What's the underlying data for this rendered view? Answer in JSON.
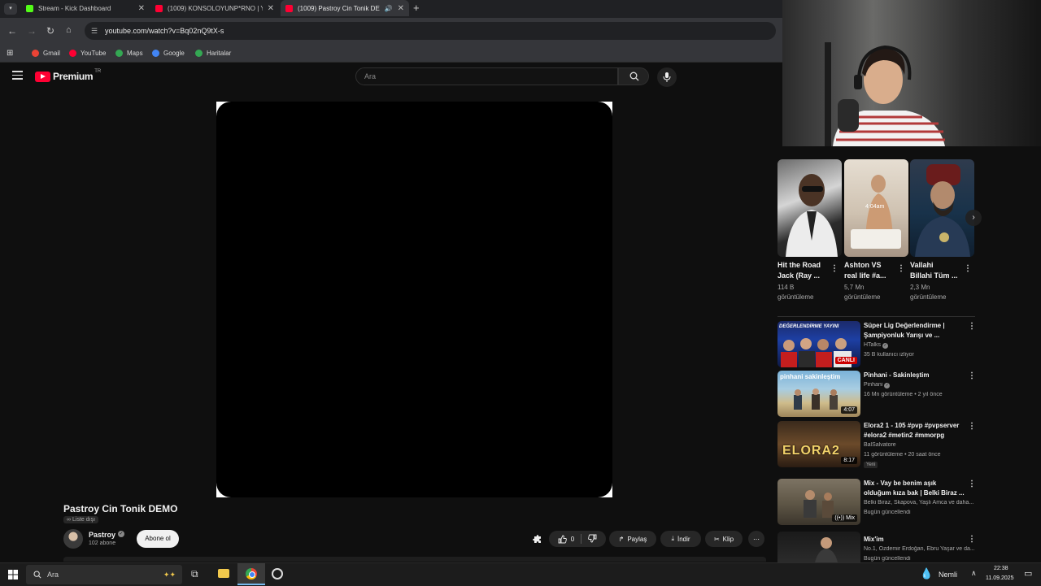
{
  "browser": {
    "tabs": [
      {
        "title": "Stream - Kick Dashboard",
        "favicon_color": "#53fc18"
      },
      {
        "title": "(1009) KONSOLOYUNP*RNO | Y",
        "favicon_color": "#ff0033"
      },
      {
        "title": "(1009) Pastroy Cin Tonik DE",
        "favicon_color": "#ff0033"
      }
    ],
    "new_tab_label": "+",
    "address": "youtube.com/watch?v=Bq02nQ9tX-s",
    "bookmarks": [
      {
        "label": "Gmail",
        "color": "#ea4335"
      },
      {
        "label": "YouTube",
        "color": "#ff0033"
      },
      {
        "label": "Maps",
        "color": "#34a853"
      },
      {
        "label": "Google",
        "color": "#4285f4"
      },
      {
        "label": "Haritalar",
        "color": "#34a853"
      }
    ]
  },
  "youtube": {
    "logo_text": "Premium",
    "region": "TR",
    "search_placeholder": "Ara",
    "accent": "#ff0033"
  },
  "video": {
    "title": "Pastroy Cin Tonik DEMO",
    "visibility": "Liste dışı",
    "channel": "Pastroy",
    "subscribers": "102 abone",
    "subscribe_label": "Abone ol",
    "likes": "0",
    "actions": {
      "share": "Paylaş",
      "download": "İndir",
      "clip": "Klip",
      "more": "⋯"
    }
  },
  "shorts": [
    {
      "title_line1": "Hit the Road",
      "title_line2": "Jack (Ray ...",
      "views_line1": "114 B",
      "views_line2": "görüntüleme",
      "overlay": ""
    },
    {
      "title_line1": "Ashton VS",
      "title_line2": "real life #a...",
      "views_line1": "5,7 Mn",
      "views_line2": "görüntüleme",
      "overlay": "4:04am"
    },
    {
      "title_line1": "Vallahi",
      "title_line2": "Billahi Tüm ...",
      "views_line1": "2,3 Mn",
      "views_line2": "görüntüleme",
      "overlay": ""
    }
  ],
  "recommendations": [
    {
      "title_line1": "Süper Lig Değerlendirme |",
      "title_line2": "Şampiyonluk Yarışı ve ...",
      "channel": "HTalks",
      "meta": "35 B kullanıcı izliyor",
      "badge": "CANLI",
      "thumb_text": "DEĞERLENDİRME YAYINI"
    },
    {
      "title_line1": "Pinhani - Sakinleştim",
      "title_line2": "",
      "channel": "Pinhani",
      "meta": "16 Mn görüntüleme • 2 yıl önce",
      "duration": "4:07",
      "thumb_text": "pinhani sakinleştim"
    },
    {
      "title_line1": "Elora2 1 - 105 #pvp #pvpserver",
      "title_line2": "#elora2 #metin2 #mmorpg",
      "channel": "BalSalvatore",
      "meta": "11 görüntüleme • 20 saat önce",
      "new_label": "Yeni",
      "duration": "8:17",
      "thumb_text": "ELORA2"
    },
    {
      "title_line1": "Mix - Vay be benim aşık",
      "title_line2": "olduğum kıza bak | Belki Biraz ...",
      "channel": "Belki Biraz, Skapova, Yaşlı Amca ve daha...",
      "meta": "Bugün güncellendi",
      "mix_label": "Mix"
    },
    {
      "title_line1": "Mix'im",
      "title_line2": "",
      "channel": "No.1, Özdemir Erdoğan, Ebru Yaşar ve da...",
      "meta": "Bugün güncellendi"
    }
  ],
  "taskbar": {
    "search_placeholder": "Ara",
    "weather": "Nemli",
    "time": "22:38",
    "date": "11.09.2025"
  }
}
